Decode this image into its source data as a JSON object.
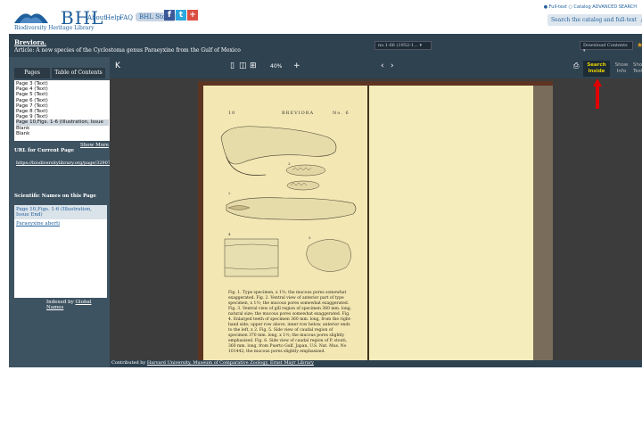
{
  "header": {
    "logo_text": "BHL",
    "logo_subtitle": "Biodiversity Heritage Library",
    "nav": {
      "about": "About",
      "help": "Help",
      "faq": "FAQ",
      "store": "BHL Store"
    },
    "social": {
      "facebook": "f",
      "twitter": "t",
      "google": "+"
    },
    "search_options": "● Full-text ○ Catalog   ADVANCED SEARCH",
    "search_placeholder": "Search the catalog and full-text"
  },
  "title_bar": {
    "title": "Breviora.",
    "article": "Article: A new species of the Cyclostoma genus Paraeyxine from the Gulf of Mexico",
    "volume": "no.1-66 (1952-1...",
    "download": "Download Contents"
  },
  "left_panel": {
    "tab_pages": "Pages",
    "tab_toc": "Table of Contents",
    "pages": [
      "Page 3 (Text)",
      "Page 4 (Text)",
      "Page 5 (Text)",
      "Page 6 (Text)",
      "Page 7 (Text)",
      "Page 8 (Text)",
      "Page 9 (Text)",
      "Page 10,Figs. 1-6 (Illustration, Issue",
      "Blank",
      "Blank"
    ],
    "selected_page": "Page 10,Figs. 1-6 (Illustration, Issue",
    "show_more": "Show More",
    "url_label": "URL for Current Page",
    "url_value": "https://biodiversitylibrary.org/page/3290769",
    "sn_label": "Scientific Names on this Page",
    "sn_page": "Page 10,Figs. 1-6 (Illustration, Issue End)",
    "sn_name": "Paraeyxine aberti",
    "indexed_prefix": "Indexed by",
    "indexed_link": "Global Names"
  },
  "toolbar": {
    "collapse": "K",
    "zoom": "40%",
    "search_inside": "Search Inside",
    "show_info": "Show Info",
    "show_text": "Show Text"
  },
  "page": {
    "number": "10",
    "running_head": "BREVIORA",
    "issue": "No. 6",
    "caption": "Fig. 1. Type specimen, x 1½; the mucous pores somewhat exaggerated. Fig. 2. Ventral view of anterior part of type specimen, x 1½; the mucous pores somewhat exaggerated. Fig. 3. Ventral view of gill region of specimen 360 mm. long, natural size; the mucous pores somewhat exaggerated. Fig. 4. Enlarged teeth of specimen 360 mm. long, from the right-hand side; upper row above, inner row below, anterior ends to the left, x 2. Fig. 5. Side view of caudal region of specimen 370 mm. long, x 1½; the mucous pores slightly emphasized. Fig. 6. Side view of caudal region of P. stouti, 360 mm. long, from Puerto Gulf, Japan, U.S. Nat. Mus. No 101442; the mucous pores slightly emphasized."
  },
  "footer": {
    "contributed_prefix": "Contributed by",
    "contributed_link": "Harvard University, Museum of Comparative Zoology, Ernst Mayr Library"
  },
  "colors": {
    "accent": "#1f5f9c",
    "toolbar": "#2f4250",
    "annotation": "#e00000"
  }
}
